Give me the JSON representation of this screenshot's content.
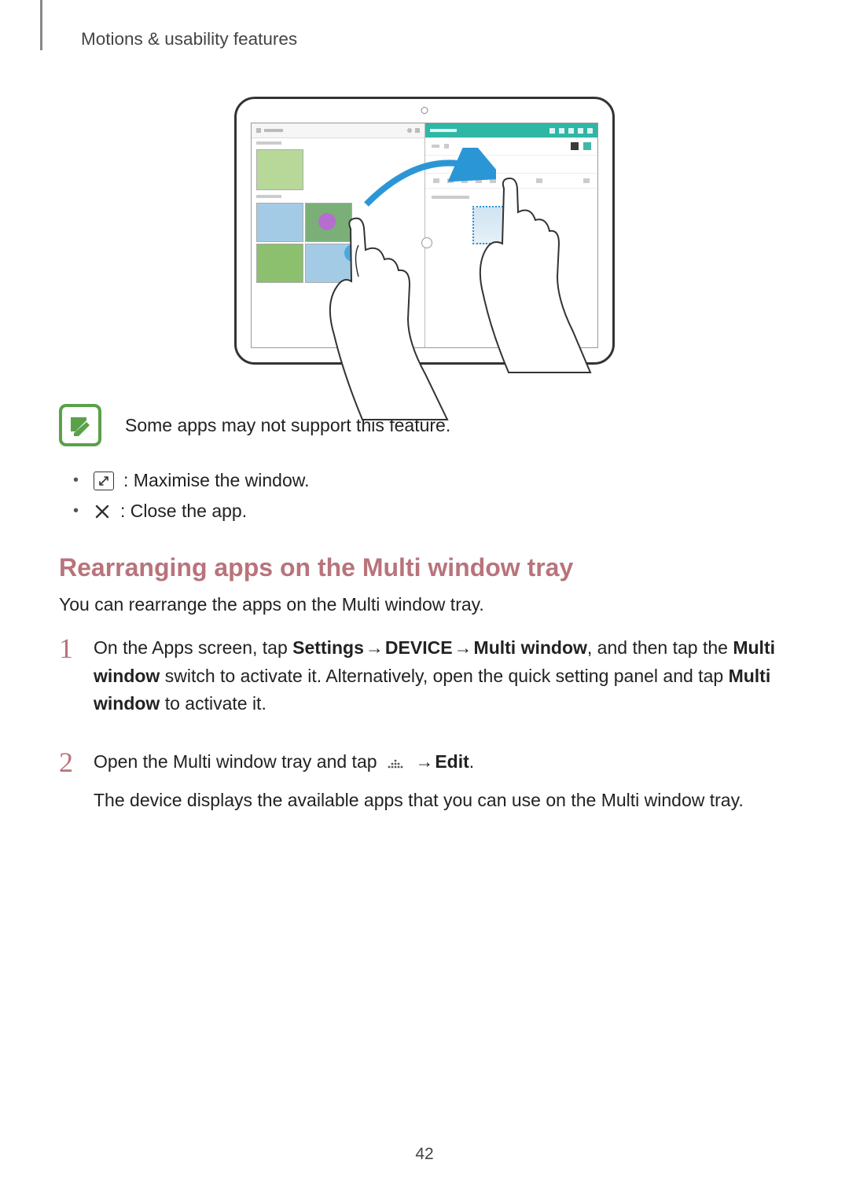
{
  "header": "Motions & usability features",
  "note_text": "Some apps may not support this feature.",
  "bullets": {
    "maximise": ": Maximise the window.",
    "close": ": Close the app."
  },
  "section_heading": "Rearranging apps on the Multi window tray",
  "section_intro": "You can rearrange the apps on the Multi window tray.",
  "steps": {
    "s1": {
      "num": "1",
      "t1": "On the Apps screen, tap ",
      "b1": "Settings",
      "a1": " → ",
      "b2": "DEVICE",
      "a2": " → ",
      "b3": "Multi window",
      "t2": ", and then tap the ",
      "b4": "Multi window",
      "t3": " switch to activate it. Alternatively, open the quick setting panel and tap ",
      "b5": "Multi window",
      "t4": " to activate it."
    },
    "s2": {
      "num": "2",
      "t1": "Open the Multi window tray and tap ",
      "a1": " → ",
      "b1": "Edit",
      "t2": ".",
      "p2": "The device displays the available apps that you can use on the Multi window tray."
    }
  },
  "page_number": "42"
}
